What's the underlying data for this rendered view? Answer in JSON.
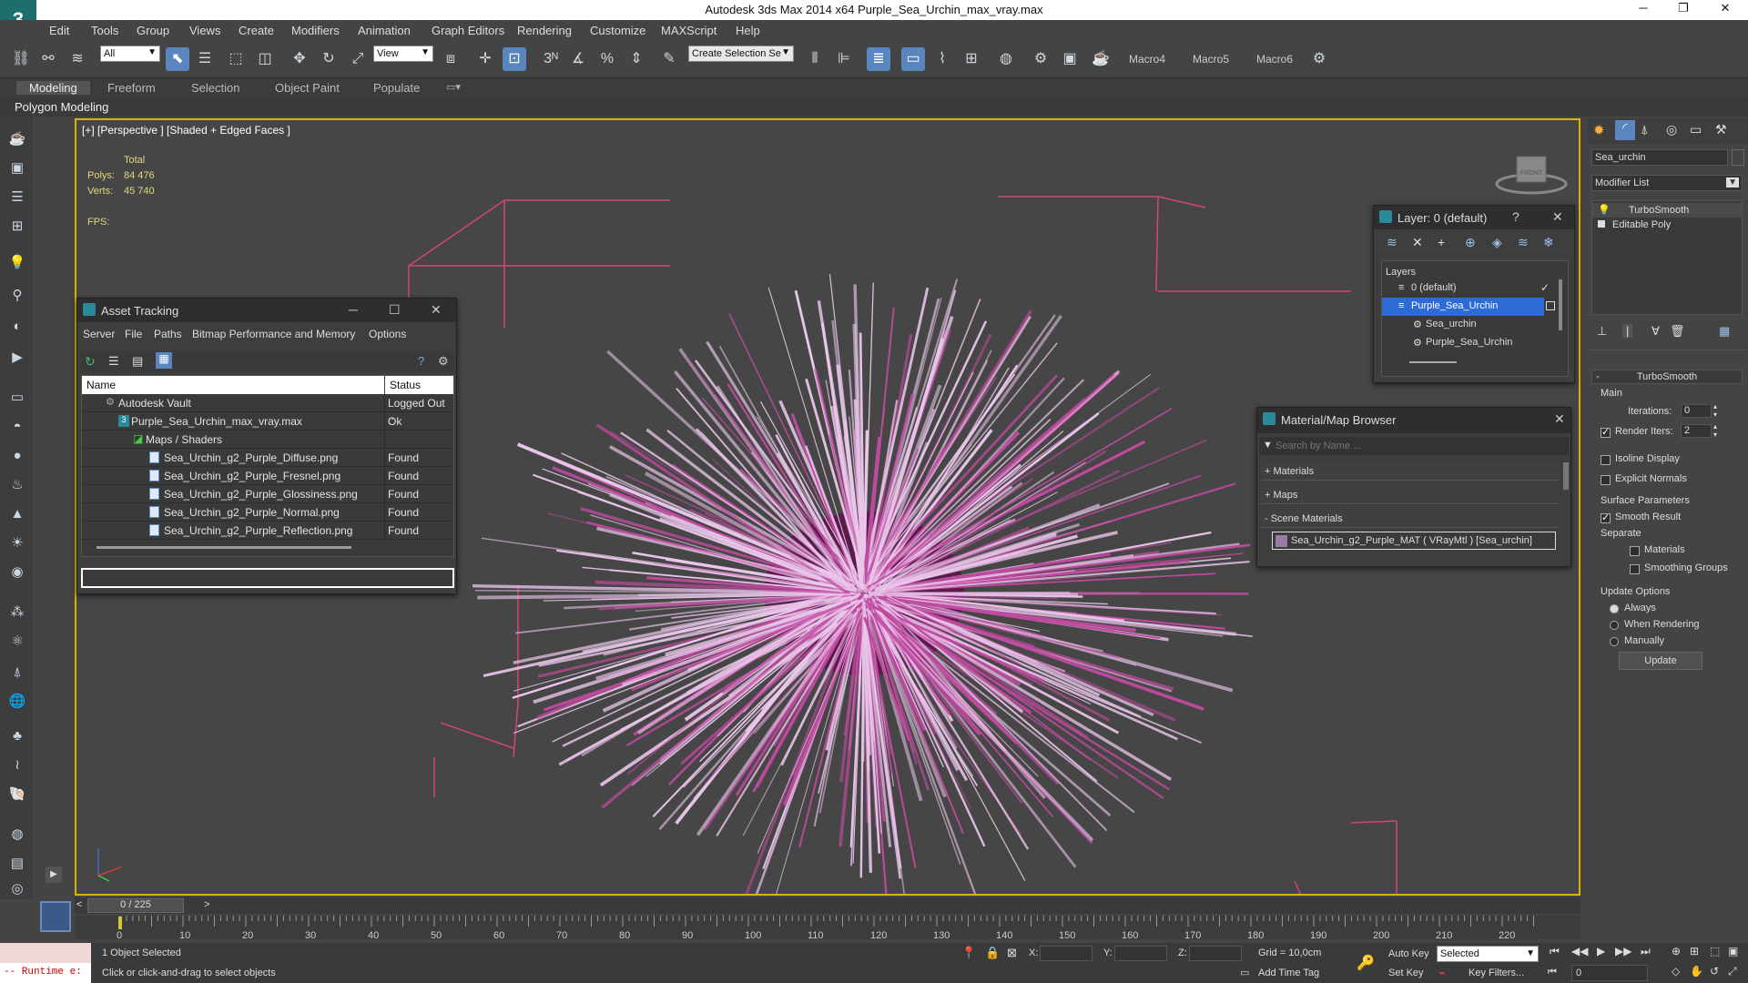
{
  "window": {
    "title": "Autodesk 3ds Max  2014 x64     Purple_Sea_Urchin_max_vray.max",
    "app_logo": "3"
  },
  "menu": [
    "Edit",
    "Tools",
    "Group",
    "Views",
    "Create",
    "Modifiers",
    "Animation",
    "Graph Editors",
    "Rendering",
    "Customize",
    "MAXScript",
    "Help"
  ],
  "toolbar": {
    "filter_select": "All",
    "ref_coord": "View",
    "named_selection": "Create Selection Se",
    "snap_label": "3",
    "macros": [
      "Macro4",
      "Macro5",
      "Macro6"
    ]
  },
  "ribbon": {
    "tabs": [
      "Modeling",
      "Freeform",
      "Selection",
      "Object Paint",
      "Populate"
    ],
    "panel_label": "Polygon Modeling"
  },
  "viewport": {
    "label": "[+] [Perspective ] [Shaded + Edged Faces ]",
    "stats_total": "Total",
    "polys_label": "Polys:",
    "polys_value": "84 476",
    "verts_label": "Verts:",
    "verts_value": "45 740",
    "fps_label": "FPS:",
    "viewcube_face": "FRONT"
  },
  "asset_tracking": {
    "title": "Asset Tracking",
    "menu": [
      "Server",
      "File",
      "Paths",
      "Bitmap Performance and Memory",
      "Options"
    ],
    "columns": [
      "Name",
      "Status"
    ],
    "rows": [
      {
        "name": "Autodesk Vault",
        "status": "Logged Out ..",
        "indent": 0
      },
      {
        "name": "Purple_Sea_Urchin_max_vray.max",
        "status": "Ok",
        "indent": 1
      },
      {
        "name": "Maps / Shaders",
        "status": "",
        "indent": 2
      },
      {
        "name": "Sea_Urchin_g2_Purple_Diffuse.png",
        "status": "Found",
        "indent": 3
      },
      {
        "name": "Sea_Urchin_g2_Purple_Fresnel.png",
        "status": "Found",
        "indent": 3
      },
      {
        "name": "Sea_Urchin_g2_Purple_Glossiness.png",
        "status": "Found",
        "indent": 3
      },
      {
        "name": "Sea_Urchin_g2_Purple_Normal.png",
        "status": "Found",
        "indent": 3
      },
      {
        "name": "Sea_Urchin_g2_Purple_Reflection.png",
        "status": "Found",
        "indent": 3
      }
    ]
  },
  "layer_window": {
    "title": "Layer: 0 (default)",
    "header": "Layers",
    "items": [
      "0 (default)",
      "Purple_Sea_Urchin",
      "Sea_urchin",
      "Purple_Sea_Urchin"
    ]
  },
  "material_browser": {
    "title": "Material/Map Browser",
    "search_placeholder": "Search by Name ...",
    "groups": [
      "+ Materials",
      "+ Maps",
      "- Scene Materials"
    ],
    "scene_material": "Sea_Urchin_g2_Purple_MAT  ( VRayMtl )  [Sea_urchin]"
  },
  "command_panel": {
    "object_name": "Sea_urchin",
    "modifier_list": "Modifier List",
    "stack": [
      "TurboSmooth",
      "Editable Poly"
    ],
    "rollout_title": "TurboSmooth",
    "main_label": "Main",
    "iterations_label": "Iterations:",
    "iterations_value": "0",
    "render_iters_label": "Render Iters:",
    "render_iters_value": "2",
    "render_iters_checked": true,
    "isoline_label": "Isoline Display",
    "explicit_normals_label": "Explicit Normals",
    "surface_params_label": "Surface Parameters",
    "smooth_result_label": "Smooth Result",
    "separate_label": "Separate",
    "materials_label": "Materials",
    "smoothing_groups_label": "Smoothing Groups",
    "update_options_label": "Update Options",
    "always_label": "Always",
    "when_rendering_label": "When Rendering",
    "manually_label": "Manually",
    "update_button": "Update"
  },
  "timeline": {
    "frame_counter": "0 / 225",
    "ticks": [
      "0",
      "10",
      "20",
      "30",
      "40",
      "50",
      "60",
      "70",
      "80",
      "90",
      "100",
      "110",
      "120",
      "130",
      "140",
      "150",
      "160",
      "170",
      "180",
      "190",
      "200",
      "210",
      "220"
    ]
  },
  "status": {
    "script_listener": "-- Runtime e:",
    "selection_info": "1 Object Selected",
    "prompt": "Click or click-and-drag to select objects",
    "x_label": "X:",
    "y_label": "Y:",
    "z_label": "Z:",
    "grid": "Grid = 10,0cm",
    "add_time_tag": "Add Time Tag",
    "auto_key": "Auto Key",
    "set_key": "Set Key",
    "selected_dropdown": "Selected",
    "key_filters": "Key Filters...",
    "current_frame": "0"
  },
  "colors": {
    "viewport_border": "#d8b400",
    "selection_blue": "#2d6bd6",
    "urchin_spine": "#e9c6ea",
    "urchin_core": "#5a1a4a"
  }
}
